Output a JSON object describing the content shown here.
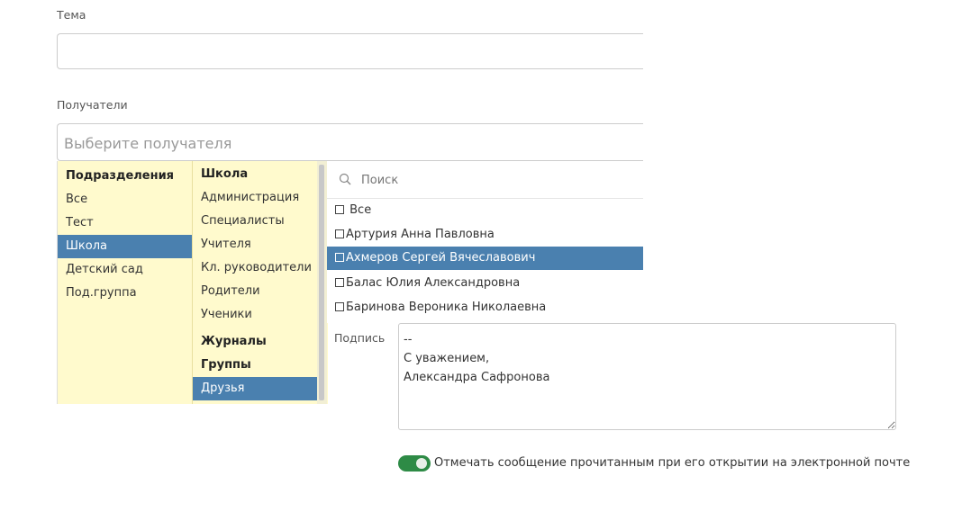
{
  "subject": {
    "label": "Тема",
    "value": ""
  },
  "recipients": {
    "label": "Получатели",
    "placeholder": "Выберите получателя",
    "departments": {
      "header": "Подразделения",
      "items": [
        "Все",
        "Тест",
        "Школа",
        "Детский сад",
        "Под.группа"
      ],
      "selected": "Школа"
    },
    "school": {
      "header": "Школа",
      "items": [
        "Администрация",
        "Специалисты",
        "Учителя",
        "Кл. руководители",
        "Родители",
        "Ученики"
      ],
      "journals_header": "Журналы",
      "groups_header": "Группы",
      "group_items": [
        "Друзья"
      ],
      "selected": "Друзья"
    },
    "search_placeholder": "Поиск",
    "people": [
      "Все",
      "Артурия Анна Павловна",
      "Ахмеров Сергей Вячеславович",
      "Балас Юлия Александровна",
      "Баринова Вероника Николаевна"
    ],
    "highlighted": "Ахмеров Сергей Вячеславович"
  },
  "signature": {
    "label": "Подпись",
    "value": "--\nС уважением,\nАлександра Сафронова"
  },
  "read_receipt": {
    "label": "Отмечать сообщение прочитанным при его открытии на электронной почте",
    "enabled": true
  },
  "colors": {
    "panel_bg": "#fffacd",
    "selection": "#4a80af",
    "toggle_on": "#2e8b46"
  }
}
